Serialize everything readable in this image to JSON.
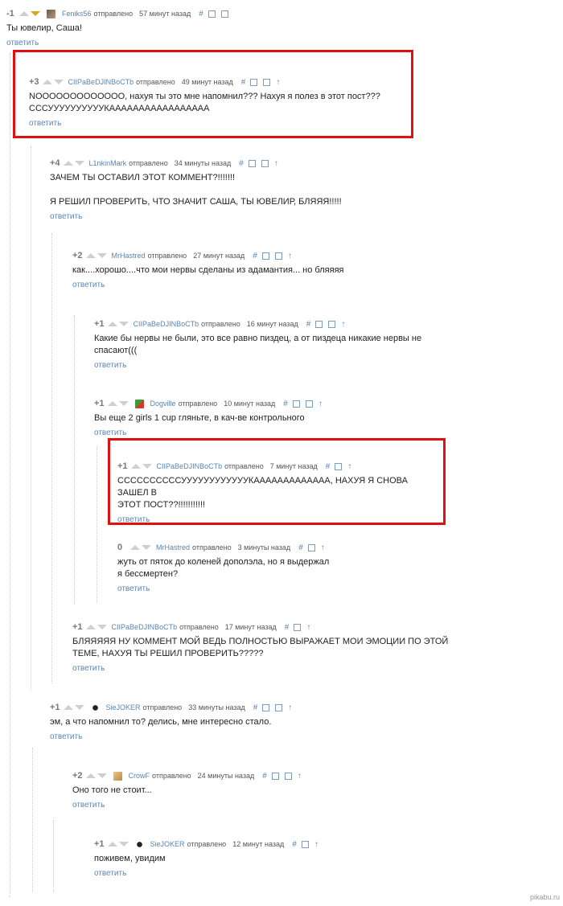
{
  "labels": {
    "sent": "отправлено",
    "reply": "ответить",
    "anchor": "#",
    "up": "↑"
  },
  "colors": {
    "link": "#5b84b1",
    "highlight": "#e01010",
    "voted_down": "#d9a61a"
  },
  "comments": [
    {
      "rating": "-1",
      "author": "Feniks56",
      "time": "57 минут назад",
      "text": [
        "Ты ювелир, Саша!"
      ],
      "avatar": "user-avatar-photo",
      "voted_down": true,
      "tools": [
        "anchor-icon",
        "collapse-icon",
        "save-icon"
      ]
    },
    {
      "rating": "+3",
      "author": "CIIPaBeDJINBoCTb",
      "time": "49 минут назад",
      "text": [
        "NOOOOOOOOOOOOO, нахуя ты это мне напомнил??? Нахуя я полез в этот пост???",
        "СССУУУУУУУУУУКААААААААААААААААА"
      ],
      "tools": [
        "anchor-icon",
        "collapse-icon",
        "save-icon",
        "parent-arrow-icon"
      ]
    },
    {
      "rating": "+4",
      "author": "L1nkinMark",
      "time": "34 минуты назад",
      "text": [
        "ЗАЧЕМ ТЫ ОСТАВИЛ ЭТОТ КОММЕНТ?!!!!!!!",
        "",
        "Я РЕШИЛ ПРОВЕРИТЬ, ЧТО ЗНАЧИТ САША, ТЫ ЮВЕЛИР, БЛЯЯЯ!!!!!"
      ],
      "tools": [
        "anchor-icon",
        "collapse-icon",
        "save-icon",
        "parent-arrow-icon"
      ]
    },
    {
      "rating": "+2",
      "author": "MrHastred",
      "time": "27 минут назад",
      "text": [
        "как....хорошо....что мои нервы сделаны из адамантия... но бляяяя"
      ],
      "tools": [
        "anchor-icon",
        "collapse-icon",
        "save-icon",
        "parent-arrow-icon"
      ]
    },
    {
      "rating": "+1",
      "author": "CIIPaBeDJINBoCTb",
      "time": "16 минут назад",
      "text": [
        "Какие бы нервы не были, это все равно пиздец, а от пиздеца никакие нервы не",
        "спасают((("
      ],
      "tools": [
        "anchor-icon",
        "collapse-icon",
        "save-icon",
        "parent-arrow-icon"
      ]
    },
    {
      "rating": "+1",
      "author": "Dogville",
      "time": "10 минут назад",
      "text": [
        "Вы еще 2 girls 1 cup гляньте, в кач-ве контрольного"
      ],
      "avatar": "user-avatar-cartoon",
      "tools": [
        "anchor-icon",
        "collapse-icon",
        "save-icon",
        "parent-arrow-icon"
      ]
    },
    {
      "rating": "+1",
      "author": "CIIPaBeDJINBoCTb",
      "time": "7 минут назад",
      "text": [
        "ССССССССССУУУУУУУУУУУУКААААААААААААА, НАХУЯ Я СНОВА ЗАШЕЛ В",
        "ЭТОТ ПОСТ??!!!!!!!!!!!"
      ],
      "tools": [
        "anchor-icon",
        "save-icon",
        "parent-arrow-icon"
      ]
    },
    {
      "rating": "0",
      "author": "MrHastred",
      "time": "3 минуты назад",
      "text": [
        "жуть от пяток до коленей дополэла, но я выдержал",
        "я бессмертен?"
      ],
      "tools": [
        "anchor-icon",
        "save-icon",
        "parent-arrow-icon"
      ]
    },
    {
      "rating": "+1",
      "author": "CIIPaBeDJINBoCTb",
      "time": "17 минут назад",
      "text": [
        "БЛЯЯЯЯЯ НУ КОММЕНТ МОЙ ВЕДЬ ПОЛНОСТЬЮ ВЫРАЖАЕТ МОИ ЭМОЦИИ ПО ЭТОЙ",
        "ТЕМЕ, НАХУЯ ТЫ РЕШИЛ ПРОВЕРИТЬ?????"
      ],
      "tools": [
        "anchor-icon",
        "save-icon",
        "parent-arrow-icon"
      ]
    },
    {
      "rating": "+1",
      "author": "SieJOKER",
      "time": "33 минуты назад",
      "text": [
        "эм, а что напомнил то? делись, мне интересно стало."
      ],
      "avatar": "user-avatar-spider",
      "tools": [
        "anchor-icon",
        "collapse-icon",
        "save-icon",
        "parent-arrow-icon"
      ]
    },
    {
      "rating": "+2",
      "author": "CrowF",
      "time": "24 минуты назад",
      "text": [
        "Оно того не стоит..."
      ],
      "avatar": "user-avatar-crow",
      "tools": [
        "anchor-icon",
        "collapse-icon",
        "save-icon",
        "parent-arrow-icon"
      ]
    },
    {
      "rating": "+1",
      "author": "SieJOKER",
      "time": "12 минут назад",
      "text": [
        "поживем, увидим"
      ],
      "avatar": "user-avatar-spider",
      "tools": [
        "anchor-icon",
        "save-icon",
        "parent-arrow-icon"
      ]
    }
  ],
  "watermark": "pikabu.ru"
}
